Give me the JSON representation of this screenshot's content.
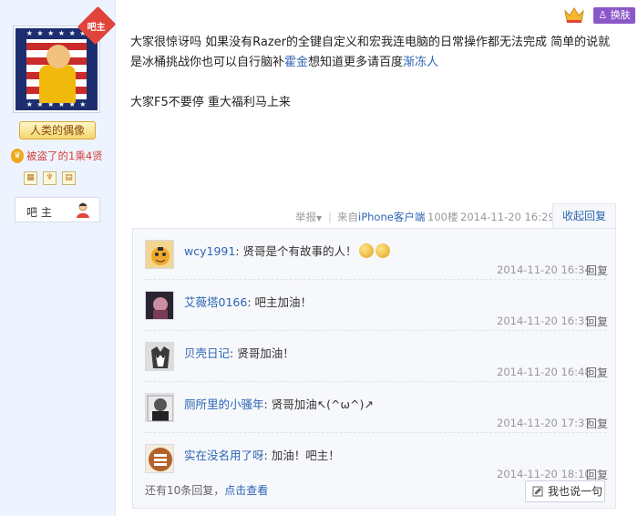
{
  "profile": {
    "badge": "吧主",
    "level_title": "人类的偶像",
    "rank_text": "被盗了的1乘4贤",
    "role": "吧 主"
  },
  "topbar": {
    "change_skin_label": "换肤"
  },
  "post": {
    "line1": "大家很惊讶吗 如果没有Razer的全键自定义和宏我连电脑的日常操作都无法完成 简单的说就",
    "line2_prefix": "是冰桶挑战你也可以自行脑补",
    "line2_link1": "霍金",
    "line2_mid": "想知道更多请百度",
    "line2_link2": "渐冻人",
    "line3": "大家F5不要停 重大福利马上来",
    "meta": {
      "report": "举报",
      "separator": "|",
      "client_prefix": "来自",
      "client": "iPhone客户端",
      "floor": "100楼",
      "time": "2014-11-20 16:29"
    },
    "collapse_label": "收起回复"
  },
  "replies": [
    {
      "user": "wcy1991",
      "text": "贤哥是个有故事的人！",
      "emoji_count": 2,
      "time": "2014-11-20 16:34",
      "reply_label": "回复"
    },
    {
      "user": "艾薇塔0166",
      "text": "吧主加油！",
      "emoji_count": 0,
      "time": "2014-11-20 16:35",
      "reply_label": "回复"
    },
    {
      "user": "贝壳日记",
      "text": "贤哥加油！",
      "emoji_count": 0,
      "time": "2014-11-20 16:48",
      "reply_label": "回复"
    },
    {
      "user": "厕所里的小骚年",
      "text": "贤哥加油↖(^ω^)↗",
      "emoji_count": 0,
      "time": "2014-11-20 17:37",
      "reply_label": "回复"
    },
    {
      "user": "实在没名用了呀",
      "text": "加油！吧主！",
      "emoji_count": 0,
      "time": "2014-11-20 18:10",
      "reply_label": "回复"
    }
  ],
  "footer": {
    "more_prefix": "还有10条回复，",
    "view_link": "点击查看",
    "say_button": "我也说一句"
  },
  "colors": {
    "link": "#2d64b3",
    "rank_red": "#d43f3a",
    "skin_purple": "#8c57c9",
    "badge_red": "#e0443b"
  }
}
